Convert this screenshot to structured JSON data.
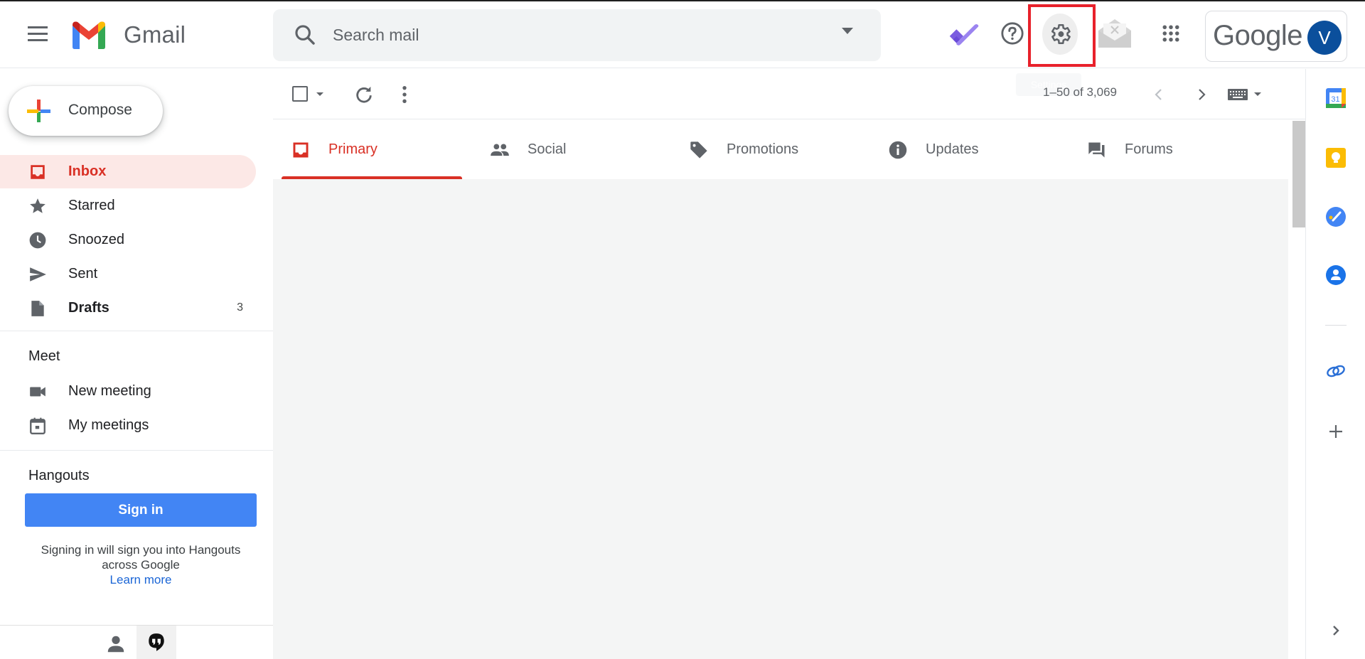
{
  "app": {
    "name": "Gmail",
    "brand_colors": {
      "red": "#ea4335",
      "blue": "#4285f4",
      "yellow": "#fbbc04",
      "green": "#34a853",
      "accent_red": "#d93025"
    }
  },
  "header": {
    "menu_icon": "hamburger-menu-icon",
    "logo_text": "Gmail",
    "search": {
      "placeholder": "Search mail",
      "value": ""
    },
    "icons": [
      "tasks-icon",
      "help-icon",
      "settings-icon",
      "offline-mail-icon",
      "apps-grid-icon"
    ],
    "account": {
      "brand": "Google",
      "avatar_initial": "V",
      "avatar_color": "#0b4f9c"
    },
    "highlighted": "settings-icon",
    "tooltip": "Settings"
  },
  "sidebar": {
    "compose_label": "Compose",
    "items": [
      {
        "label": "Inbox",
        "icon": "inbox-icon",
        "active": true,
        "count": ""
      },
      {
        "label": "Starred",
        "icon": "star-icon",
        "active": false,
        "count": ""
      },
      {
        "label": "Snoozed",
        "icon": "clock-icon",
        "active": false,
        "count": ""
      },
      {
        "label": "Sent",
        "icon": "send-icon",
        "active": false,
        "count": ""
      },
      {
        "label": "Drafts",
        "icon": "draft-icon",
        "active": false,
        "count": "3"
      }
    ],
    "meet": {
      "title": "Meet",
      "items": [
        {
          "label": "New meeting",
          "icon": "video-camera-icon"
        },
        {
          "label": "My meetings",
          "icon": "calendar-icon"
        }
      ]
    },
    "hangouts": {
      "title": "Hangouts",
      "sign_in_label": "Sign in",
      "note_line1": "Signing in will sign you into Hangouts",
      "note_line2": "across Google",
      "learn_more": "Learn more"
    }
  },
  "toolbar": {
    "pagination": "1–50 of 3,069"
  },
  "tabs": [
    {
      "label": "Primary",
      "icon": "inbox-icon",
      "active": true
    },
    {
      "label": "Social",
      "icon": "people-icon",
      "active": false
    },
    {
      "label": "Promotions",
      "icon": "tag-icon",
      "active": false
    },
    {
      "label": "Updates",
      "icon": "info-icon",
      "active": false
    },
    {
      "label": "Forums",
      "icon": "forum-icon",
      "active": false
    }
  ],
  "right_panel": {
    "icons": [
      "google-calendar-icon",
      "google-keep-icon",
      "google-tasks-icon",
      "google-contacts-icon",
      "zoho-link-icon",
      "add-addon-icon",
      "expand-panel-icon"
    ],
    "calendar_day": "31"
  }
}
